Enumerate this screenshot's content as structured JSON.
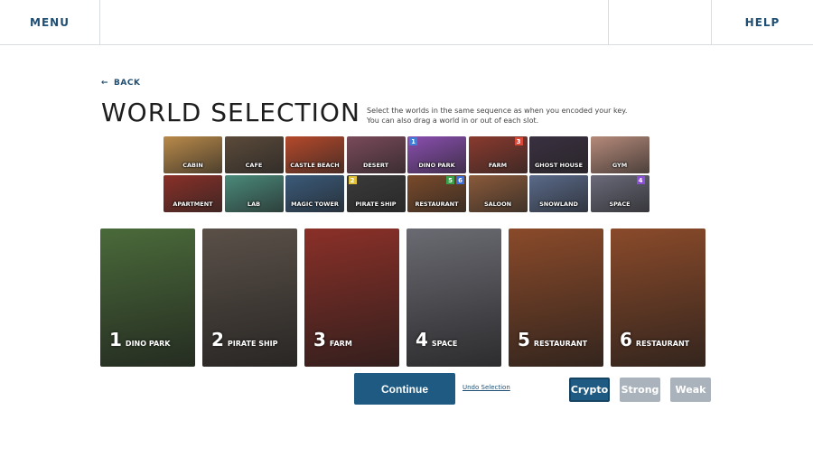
{
  "nav": {
    "menu": "MENU",
    "help": "HELP",
    "middle": ""
  },
  "back_label": "BACK",
  "title": "WORLD SELECTION",
  "instructions": {
    "line1": "Select the worlds in the same sequence as when you encoded your key.",
    "line2": "You can also drag a world in or out of each slot."
  },
  "worlds": [
    {
      "label": "CABIN",
      "color": "#b98a4a",
      "badges": []
    },
    {
      "label": "CAFE",
      "color": "#5b4a3a",
      "badges": []
    },
    {
      "label": "CASTLE BEACH",
      "color": "#b5492b",
      "badges": []
    },
    {
      "label": "DESERT",
      "color": "#7a4a5a",
      "badges": []
    },
    {
      "label": "DINO PARK",
      "color": "#8a4fb0",
      "badges": [
        {
          "n": "1",
          "color": "#3b7fd9"
        }
      ]
    },
    {
      "label": "FARM",
      "color": "#8a3a2e",
      "badges": [
        {
          "n": "3",
          "color": "#d94a3b"
        }
      ]
    },
    {
      "label": "GHOST HOUSE",
      "color": "#3a3040",
      "badges": []
    },
    {
      "label": "GYM",
      "color": "#b58a7a",
      "badges": []
    },
    {
      "label": "APARTMENT",
      "color": "#8a3028",
      "badges": []
    },
    {
      "label": "LAB",
      "color": "#4a8a7a",
      "badges": []
    },
    {
      "label": "MAGIC TOWER",
      "color": "#3a5a7a",
      "badges": []
    },
    {
      "label": "PIRATE SHIP",
      "color": "#3a3a3a",
      "badges": [
        {
          "n": "2",
          "color": "#e0c23a"
        }
      ]
    },
    {
      "label": "RESTAURANT",
      "color": "#7a4a2a",
      "badges": [
        {
          "n": "5",
          "color": "#3aa04a"
        },
        {
          "n": "6",
          "color": "#3b6fd9"
        }
      ]
    },
    {
      "label": "SALOON",
      "color": "#8a5a3a",
      "badges": []
    },
    {
      "label": "SNOWLAND",
      "color": "#5a6a8a",
      "badges": []
    },
    {
      "label": "SPACE",
      "color": "#6a6a7a",
      "badges": [
        {
          "n": "4",
          "color": "#8a4fd9"
        }
      ]
    }
  ],
  "slots": [
    {
      "num": "1",
      "name": "DINO PARK",
      "color": "#4a6a3a"
    },
    {
      "num": "2",
      "name": "PIRATE SHIP",
      "color": "#5a5048"
    },
    {
      "num": "3",
      "name": "FARM",
      "color": "#8a3028"
    },
    {
      "num": "4",
      "name": "SPACE",
      "color": "#6a6a72"
    },
    {
      "num": "5",
      "name": "RESTAURANT",
      "color": "#8a4a2a"
    },
    {
      "num": "6",
      "name": "RESTAURANT",
      "color": "#8a4a2a"
    }
  ],
  "continue_label": "Continue",
  "undo_label": "Undo Selection",
  "modes": {
    "crypto": "Crypto",
    "strong": "Strong",
    "weak": "Weak"
  }
}
